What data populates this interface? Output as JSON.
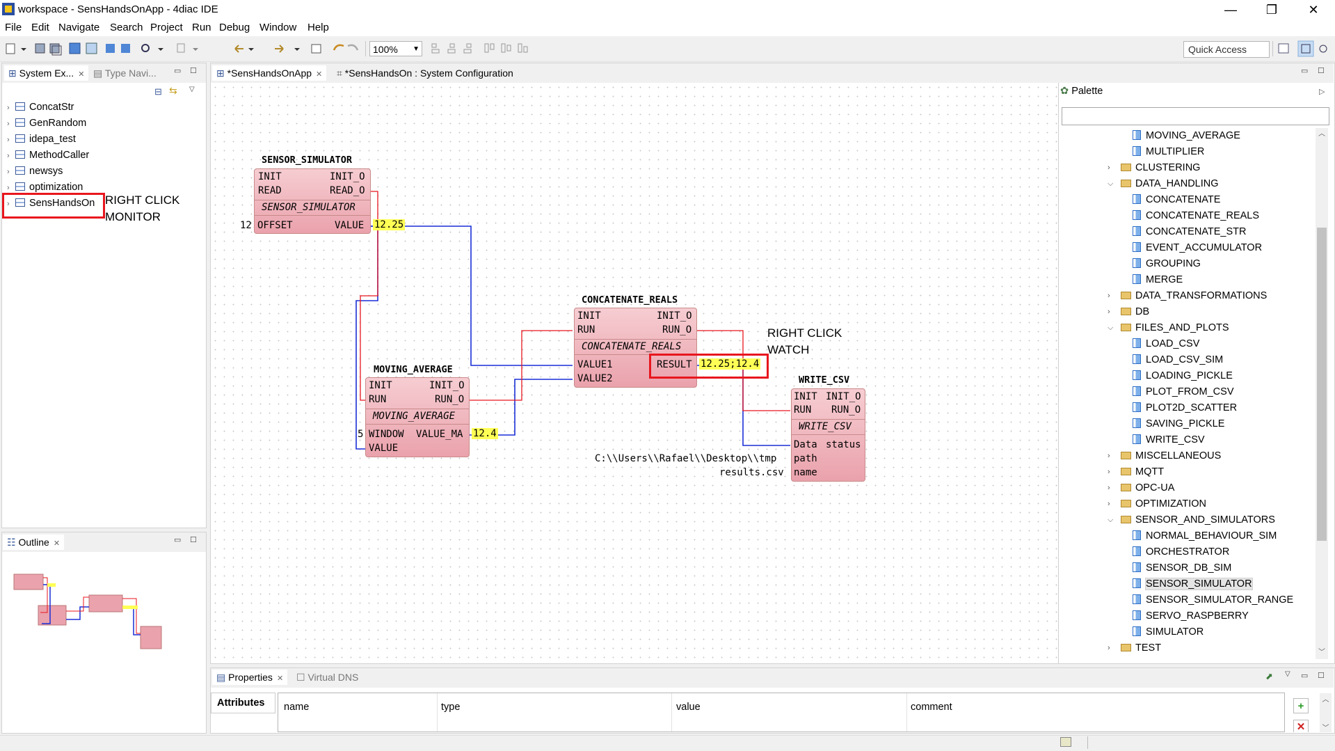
{
  "window": {
    "title": "workspace - SensHandsOnApp - 4diac IDE",
    "minimize": "—",
    "restore": "❐",
    "close": "✕"
  },
  "menu": [
    "File",
    "Edit",
    "Navigate",
    "Search",
    "Project",
    "Run",
    "Debug",
    "Window",
    "Help"
  ],
  "toolbar": {
    "zoom": "100%",
    "quick_access": "Quick Access"
  },
  "system_explorer": {
    "tabs": [
      {
        "label": "System Ex..."
      },
      {
        "label": "Type Navi..."
      }
    ],
    "items": [
      "ConcatStr",
      "GenRandom",
      "idepa_test",
      "MethodCaller",
      "newsys",
      "optimization",
      "SensHandsOn"
    ]
  },
  "outline": {
    "tab": "Outline"
  },
  "editor": {
    "tabs": [
      {
        "label": "*SensHandsOnApp"
      },
      {
        "label": "*SensHandsOn : System Configuration"
      }
    ]
  },
  "diagram": {
    "sensor_simulator": {
      "title": "SENSOR_SIMULATOR",
      "type": "SENSOR_SIMULATOR",
      "in": [
        "INIT",
        "READ",
        "OFFSET"
      ],
      "out": [
        "INIT_O",
        "READ_O",
        "VALUE"
      ],
      "offset_const": "12",
      "value_watch": "12.25"
    },
    "moving_average": {
      "title": "MOVING_AVERAGE",
      "type": "MOVING_AVERAGE",
      "in": [
        "INIT",
        "RUN",
        "WINDOW",
        "VALUE"
      ],
      "out": [
        "INIT_O",
        "RUN_O",
        "VALUE_MA"
      ],
      "window_const": "5",
      "value_watch": "12.4"
    },
    "concatenate_reals": {
      "title": "CONCATENATE_REALS",
      "type": "CONCATENATE_REALS",
      "in": [
        "INIT",
        "RUN",
        "VALUE1",
        "VALUE2"
      ],
      "out": [
        "INIT_O",
        "RUN_O",
        "RESULT"
      ],
      "result_watch": "12.25;12.4"
    },
    "write_csv": {
      "title": "WRITE_CSV",
      "type": "WRITE_CSV",
      "in": [
        "INIT",
        "RUN",
        "Data",
        "path",
        "name"
      ],
      "out": [
        "INIT_O",
        "RUN_O",
        "status"
      ],
      "path_const": "C:\\\\Users\\\\Rafael\\\\Desktop\\\\tmp",
      "name_const": "results.csv"
    },
    "annotations": {
      "monitor": [
        "RIGHT CLICK",
        "MONITOR"
      ],
      "watch": [
        "RIGHT CLICK",
        "WATCH"
      ]
    }
  },
  "palette": {
    "title": "Palette",
    "items": [
      {
        "label": "MOVING_AVERAGE",
        "kind": "fb",
        "level": 2
      },
      {
        "label": "MULTIPLIER",
        "kind": "fb",
        "level": 2
      },
      {
        "label": "CLUSTERING",
        "kind": "folder",
        "level": 1,
        "state": "collapsed"
      },
      {
        "label": "DATA_HANDLING",
        "kind": "folder",
        "level": 1,
        "state": "expanded"
      },
      {
        "label": "CONCATENATE",
        "kind": "fb",
        "level": 2
      },
      {
        "label": "CONCATENATE_REALS",
        "kind": "fb",
        "level": 2
      },
      {
        "label": "CONCATENATE_STR",
        "kind": "fb",
        "level": 2
      },
      {
        "label": "EVENT_ACCUMULATOR",
        "kind": "fb",
        "level": 2
      },
      {
        "label": "GROUPING",
        "kind": "fb",
        "level": 2
      },
      {
        "label": "MERGE",
        "kind": "fb",
        "level": 2
      },
      {
        "label": "DATA_TRANSFORMATIONS",
        "kind": "folder",
        "level": 1,
        "state": "collapsed"
      },
      {
        "label": "DB",
        "kind": "folder",
        "level": 1,
        "state": "collapsed"
      },
      {
        "label": "FILES_AND_PLOTS",
        "kind": "folder",
        "level": 1,
        "state": "expanded"
      },
      {
        "label": "LOAD_CSV",
        "kind": "fb",
        "level": 2
      },
      {
        "label": "LOAD_CSV_SIM",
        "kind": "fb",
        "level": 2
      },
      {
        "label": "LOADING_PICKLE",
        "kind": "fb",
        "level": 2
      },
      {
        "label": "PLOT_FROM_CSV",
        "kind": "fb",
        "level": 2
      },
      {
        "label": "PLOT2D_SCATTER",
        "kind": "fb",
        "level": 2
      },
      {
        "label": "SAVING_PICKLE",
        "kind": "fb",
        "level": 2
      },
      {
        "label": "WRITE_CSV",
        "kind": "fb",
        "level": 2
      },
      {
        "label": "MISCELLANEOUS",
        "kind": "folder",
        "level": 1,
        "state": "collapsed"
      },
      {
        "label": "MQTT",
        "kind": "folder",
        "level": 1,
        "state": "collapsed"
      },
      {
        "label": "OPC-UA",
        "kind": "folder",
        "level": 1,
        "state": "collapsed"
      },
      {
        "label": "OPTIMIZATION",
        "kind": "folder",
        "level": 1,
        "state": "collapsed"
      },
      {
        "label": "SENSOR_AND_SIMULATORS",
        "kind": "folder",
        "level": 1,
        "state": "expanded"
      },
      {
        "label": "NORMAL_BEHAVIOUR_SIM",
        "kind": "fb",
        "level": 2
      },
      {
        "label": "ORCHESTRATOR",
        "kind": "fb",
        "level": 2
      },
      {
        "label": "SENSOR_DB_SIM",
        "kind": "fb",
        "level": 2
      },
      {
        "label": "SENSOR_SIMULATOR",
        "kind": "fb",
        "level": 2,
        "selected": true
      },
      {
        "label": "SENSOR_SIMULATOR_RANGE",
        "kind": "fb",
        "level": 2
      },
      {
        "label": "SERVO_RASPBERRY",
        "kind": "fb",
        "level": 2
      },
      {
        "label": "SIMULATOR",
        "kind": "fb",
        "level": 2
      },
      {
        "label": "TEST",
        "kind": "folder",
        "level": 1,
        "state": "collapsed"
      }
    ]
  },
  "properties": {
    "tabs": [
      {
        "label": "Properties"
      },
      {
        "label": "Virtual DNS"
      }
    ],
    "section": "Attributes",
    "columns": [
      "name",
      "type",
      "value",
      "comment"
    ]
  },
  "colors": {
    "event_line": "#e8161e",
    "data_line": "#1a2fd6",
    "fb_fill": "#f0b7bf",
    "watch": "#ffff55",
    "highlight": "#e8161e"
  }
}
